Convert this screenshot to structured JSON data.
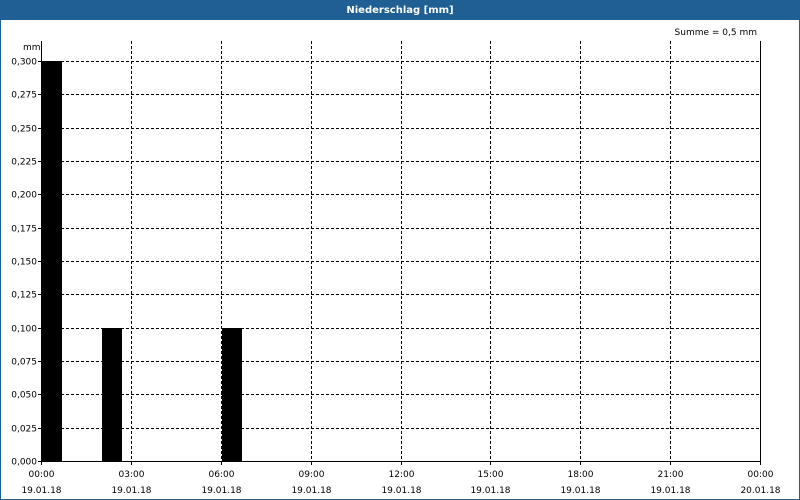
{
  "chart_data": {
    "type": "bar",
    "title": "Niederschlag [mm]",
    "unit_label": "mm",
    "annotation": "Summe = 0,5 mm",
    "ylim": [
      0,
      0.3
    ],
    "xlim_hours": [
      0,
      24
    ],
    "y_ticks": [
      "0,000",
      "0,025",
      "0,050",
      "0,075",
      "0,100",
      "0,125",
      "0,150",
      "0,175",
      "0,200",
      "0,225",
      "0,250",
      "0,275",
      "0,300"
    ],
    "x_ticks": [
      {
        "time": "00:00",
        "date": "19.01.18"
      },
      {
        "time": "03:00",
        "date": "19.01.18"
      },
      {
        "time": "06:00",
        "date": "19.01.18"
      },
      {
        "time": "09:00",
        "date": "19.01.18"
      },
      {
        "time": "12:00",
        "date": "19.01.18"
      },
      {
        "time": "15:00",
        "date": "19.01.18"
      },
      {
        "time": "18:00",
        "date": "19.01.18"
      },
      {
        "time": "21:00",
        "date": "19.01.18"
      },
      {
        "time": "00:00",
        "date": "20.01.18"
      }
    ],
    "bars": [
      {
        "start": "00:00",
        "end": "00:40",
        "value": 0.3
      },
      {
        "start": "02:00",
        "end": "02:40",
        "value": 0.1
      },
      {
        "start": "06:00",
        "end": "06:40",
        "value": 0.1
      }
    ],
    "grid": true,
    "bar_color": "#000000"
  }
}
